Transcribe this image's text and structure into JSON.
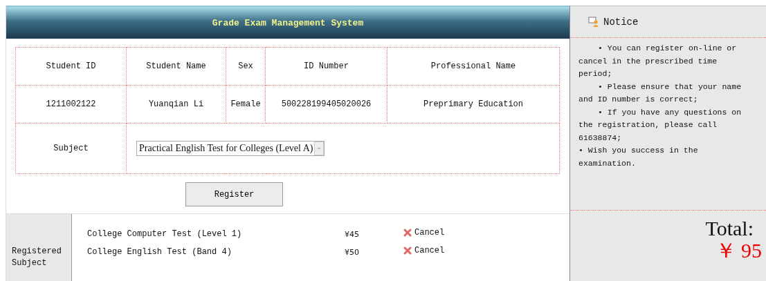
{
  "header": {
    "title": "Grade Exam Management System"
  },
  "table": {
    "columns": [
      "Student ID",
      "Student Name",
      "Sex",
      "ID Number",
      "Professional Name"
    ],
    "row": [
      "1211002122",
      "Yuanqian Li",
      "Female",
      "500228199405020026",
      "Preprimary Education"
    ],
    "subject_label": "Subject",
    "subject_value": "Practical English Test for Colleges (Level A)"
  },
  "register_button": "Register",
  "registered": {
    "label": "Registered Subject",
    "items": [
      {
        "name": "College Computer Test (Level 1)",
        "price": "¥45",
        "action": "Cancel"
      },
      {
        "name": "College English Test (Band 4)",
        "price": "¥50",
        "action": "Cancel"
      }
    ]
  },
  "notice": {
    "title": "Notice",
    "items": [
      {
        "text": "• You can register on-line or cancel in the prescribed time period;",
        "indent": true
      },
      {
        "text": "• Please ensure that your name and ID number is correct;",
        "indent": true
      },
      {
        "text": "• If you have any questions on the registration, please call 61638874;",
        "indent": true
      },
      {
        "text": "• Wish you success in the examination.",
        "indent": false
      }
    ]
  },
  "total": {
    "label": "Total:",
    "amount": "￥ 95"
  }
}
